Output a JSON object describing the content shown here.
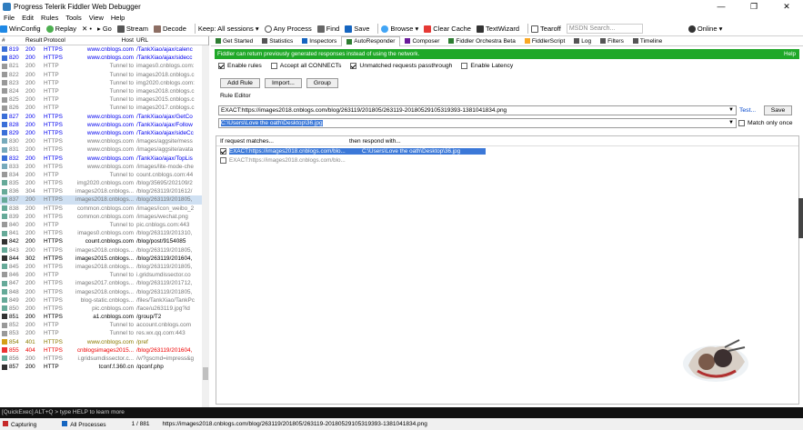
{
  "window": {
    "title": "Progress Telerik Fiddler Web Debugger",
    "minimize": "—",
    "maximize": "❐",
    "close": "✕"
  },
  "menu": [
    "File",
    "Edit",
    "Rules",
    "Tools",
    "View",
    "Help"
  ],
  "toolbar": {
    "winconfig": "WinConfig",
    "replay": "Replay",
    "remove": "✕ •",
    "go": "▸ Go",
    "stream": "Stream",
    "decode": "Decode",
    "keep": "Keep: All sessions ▾",
    "anyprocess": "Any Process",
    "find": "Find",
    "save": "Save",
    "browse": "Browse ▾",
    "clearcache": "Clear Cache",
    "textwizard": "TextWizard",
    "tearoff": "Tearoff",
    "msdn_placeholder": "MSDN Search...",
    "online": "Online ▾"
  },
  "sessions": {
    "headers": {
      "num": "#",
      "result": "Result",
      "protocol": "Protocol",
      "host": "Host",
      "url": "URL"
    },
    "rows": [
      {
        "num": "819",
        "result": "200",
        "protocol": "HTTPS",
        "host": "www.cnblogs.com",
        "url": "/TankXiao/ajax/calenc",
        "style": "rblue",
        "icon": "#3a6fd8"
      },
      {
        "num": "820",
        "result": "200",
        "protocol": "HTTPS",
        "host": "www.cnblogs.com",
        "url": "/TankXiao/ajax/sidecc",
        "style": "rblue",
        "icon": "#3a6fd8"
      },
      {
        "num": "821",
        "result": "200",
        "protocol": "HTTP",
        "host": "Tunnel to",
        "url": "images0.cnblogs.com:",
        "style": "rgray",
        "icon": "#999"
      },
      {
        "num": "822",
        "result": "200",
        "protocol": "HTTP",
        "host": "Tunnel to",
        "url": "images2018.cnblogs.c",
        "style": "rgray",
        "icon": "#999"
      },
      {
        "num": "823",
        "result": "200",
        "protocol": "HTTP",
        "host": "Tunnel to",
        "url": "img2020.cnblogs.com:",
        "style": "rgray",
        "icon": "#999"
      },
      {
        "num": "824",
        "result": "200",
        "protocol": "HTTP",
        "host": "Tunnel to",
        "url": "images2018.cnblogs.c",
        "style": "rgray",
        "icon": "#999"
      },
      {
        "num": "825",
        "result": "200",
        "protocol": "HTTP",
        "host": "Tunnel to",
        "url": "images2015.cnblogs.c",
        "style": "rgray",
        "icon": "#999"
      },
      {
        "num": "826",
        "result": "200",
        "protocol": "HTTP",
        "host": "Tunnel to",
        "url": "images2017.cnblogs.c",
        "style": "rgray",
        "icon": "#999"
      },
      {
        "num": "827",
        "result": "200",
        "protocol": "HTTPS",
        "host": "www.cnblogs.com",
        "url": "/TankXiao/ajax/GetCo",
        "style": "rblue",
        "icon": "#3a6fd8"
      },
      {
        "num": "828",
        "result": "200",
        "protocol": "HTTPS",
        "host": "www.cnblogs.com",
        "url": "/TankXiao/ajax/Follow",
        "style": "rblue",
        "icon": "#3a6fd8"
      },
      {
        "num": "829",
        "result": "200",
        "protocol": "HTTPS",
        "host": "www.cnblogs.com",
        "url": "/TankXiao/ajax/sideCc",
        "style": "rblue",
        "icon": "#3a6fd8"
      },
      {
        "num": "830",
        "result": "200",
        "protocol": "HTTPS",
        "host": "www.cnblogs.com",
        "url": "/images/aggsite/mess",
        "style": "rgray",
        "icon": "#7ab"
      },
      {
        "num": "831",
        "result": "200",
        "protocol": "HTTPS",
        "host": "www.cnblogs.com",
        "url": "/images/aggsite/avata",
        "style": "rgray",
        "icon": "#7ab"
      },
      {
        "num": "832",
        "result": "200",
        "protocol": "HTTPS",
        "host": "www.cnblogs.com",
        "url": "/TankXiao/ajax/TopLis",
        "style": "rblue",
        "icon": "#3a6fd8"
      },
      {
        "num": "833",
        "result": "200",
        "protocol": "HTTPS",
        "host": "www.cnblogs.com",
        "url": "/images/lite-mode-che",
        "style": "rgray",
        "icon": "#7ab"
      },
      {
        "num": "834",
        "result": "200",
        "protocol": "HTTP",
        "host": "Tunnel to",
        "url": "count.cnblogs.com:44",
        "style": "rgray",
        "icon": "#999"
      },
      {
        "num": "835",
        "result": "200",
        "protocol": "HTTPS",
        "host": "img2020.cnblogs.com",
        "url": "/blog/35695/202109/2",
        "style": "rgray",
        "icon": "#6a9"
      },
      {
        "num": "836",
        "result": "304",
        "protocol": "HTTPS",
        "host": "images2018.cnblogs...",
        "url": "/blog/263119/201612/",
        "style": "rgray",
        "icon": "#6a9"
      },
      {
        "num": "837",
        "result": "200",
        "protocol": "HTTPS",
        "host": "images2018.cnblogs...",
        "url": "/blog/263119/201805,",
        "style": "rgray rsel",
        "icon": "#6a9"
      },
      {
        "num": "838",
        "result": "200",
        "protocol": "HTTPS",
        "host": "common.cnblogs.com",
        "url": "/images/icon_weibo_2",
        "style": "rgray",
        "icon": "#6a9"
      },
      {
        "num": "839",
        "result": "200",
        "protocol": "HTTPS",
        "host": "common.cnblogs.com",
        "url": "/images/wechat.png",
        "style": "rgray",
        "icon": "#6a9"
      },
      {
        "num": "840",
        "result": "200",
        "protocol": "HTTP",
        "host": "Tunnel to",
        "url": "pic.cnblogs.com:443",
        "style": "rgray",
        "icon": "#999"
      },
      {
        "num": "841",
        "result": "200",
        "protocol": "HTTPS",
        "host": "images0.cnblogs.com",
        "url": "/blog/263119/201310,",
        "style": "rgray",
        "icon": "#6a9"
      },
      {
        "num": "842",
        "result": "200",
        "protocol": "HTTPS",
        "host": "count.cnblogs.com",
        "url": "/blog/post/9154085",
        "style": "rblack",
        "icon": "#333"
      },
      {
        "num": "843",
        "result": "200",
        "protocol": "HTTPS",
        "host": "images2018.cnblogs...",
        "url": "/blog/263119/201805,",
        "style": "rgray",
        "icon": "#6a9"
      },
      {
        "num": "844",
        "result": "302",
        "protocol": "HTTPS",
        "host": "images2015.cnblogs...",
        "url": "/blog/263119/201604,",
        "style": "rblack",
        "icon": "#333"
      },
      {
        "num": "845",
        "result": "200",
        "protocol": "HTTPS",
        "host": "images2018.cnblogs...",
        "url": "/blog/263119/201805,",
        "style": "rgray",
        "icon": "#6a9"
      },
      {
        "num": "846",
        "result": "200",
        "protocol": "HTTP",
        "host": "Tunnel to",
        "url": "i.gridsumdissector.co",
        "style": "rgray",
        "icon": "#999"
      },
      {
        "num": "847",
        "result": "200",
        "protocol": "HTTPS",
        "host": "images2017.cnblogs...",
        "url": "/blog/263119/201712,",
        "style": "rgray",
        "icon": "#6a9"
      },
      {
        "num": "848",
        "result": "200",
        "protocol": "HTTPS",
        "host": "images2018.cnblogs...",
        "url": "/blog/263119/201805,",
        "style": "rgray",
        "icon": "#6a9"
      },
      {
        "num": "849",
        "result": "200",
        "protocol": "HTTPS",
        "host": "blog-static.cnblogs...",
        "url": "/files/TankXiao/TankPc",
        "style": "rgray",
        "icon": "#6a9"
      },
      {
        "num": "850",
        "result": "200",
        "protocol": "HTTPS",
        "host": "pic.cnblogs.com",
        "url": "/face/u263119.jpg?id",
        "style": "rgray",
        "icon": "#6a9"
      },
      {
        "num": "851",
        "result": "200",
        "protocol": "HTTPS",
        "host": "a1.cnblogs.com",
        "url": "/group/T2",
        "style": "rblack",
        "icon": "#333"
      },
      {
        "num": "852",
        "result": "200",
        "protocol": "HTTP",
        "host": "Tunnel to",
        "url": "account.cnblogs.com",
        "style": "rgray",
        "icon": "#999"
      },
      {
        "num": "853",
        "result": "200",
        "protocol": "HTTP",
        "host": "Tunnel to",
        "url": "res.wx.qq.com:443",
        "style": "rgray",
        "icon": "#999"
      },
      {
        "num": "854",
        "result": "401",
        "protocol": "HTTPS",
        "host": "www.cnblogs.com",
        "url": "/pref",
        "style": "rolive",
        "icon": "#d4a017"
      },
      {
        "num": "855",
        "result": "404",
        "protocol": "HTTPS",
        "host": "cnblogsimages2015...",
        "url": "/blog/263119/201604,",
        "style": "rred",
        "icon": "#e33"
      },
      {
        "num": "856",
        "result": "200",
        "protocol": "HTTPS",
        "host": "i.gridsumdissector.c...",
        "url": "/v/?gscmd=impress&g",
        "style": "rgray",
        "icon": "#6a9"
      },
      {
        "num": "857",
        "result": "200",
        "protocol": "HTTP",
        "host": "tconf.f.360.cn",
        "url": "/qconf.php",
        "style": "rblack",
        "icon": "#333"
      }
    ]
  },
  "quickexec": "[QuickExec] ALT+Q > type HELP to learn more",
  "status": {
    "capturing": "Capturing",
    "processes": "All Processes",
    "count": "1 / 881",
    "url": "https://images2018.cnblogs.com/blog/263119/201805/263119-20180529105319393-1381041834.png"
  },
  "tabs": [
    {
      "label": "Get Started",
      "active": false
    },
    {
      "label": "Statistics",
      "active": false
    },
    {
      "label": "Inspectors",
      "active": false
    },
    {
      "label": "AutoResponder",
      "active": true
    },
    {
      "label": "Composer",
      "active": false
    },
    {
      "label": "Fiddler Orchestra Beta",
      "active": false
    },
    {
      "label": "FiddlerScript",
      "active": false
    },
    {
      "label": "Log",
      "active": false
    },
    {
      "label": "Filters",
      "active": false
    },
    {
      "label": "Timeline",
      "active": false
    }
  ],
  "autoresponder": {
    "info": "Fiddler can return previously generated responses instead of using the network.",
    "help": "Help",
    "checks": [
      {
        "label": "Enable rules",
        "checked": true
      },
      {
        "label": "Accept all CONNECTs",
        "checked": false
      },
      {
        "label": "Unmatched requests passthrough",
        "checked": true
      },
      {
        "label": "Enable Latency",
        "checked": false
      }
    ],
    "buttons": {
      "add": "Add Rule",
      "import": "Import...",
      "group": "Group"
    },
    "rule_editor_label": "Rule Editor",
    "match_value": "EXACT:https://images2018.cnblogs.com/blog/263119/201805/263119-20180529105319393-1381041834.png",
    "respond_value": "C:\\Users\\Love the oath\\Desktop\\36.jpg",
    "test": "Test...",
    "save": "Save",
    "match_only_once": "Match only once",
    "table_headers": {
      "match": "If request matches...",
      "respond": "then respond with..."
    },
    "rules": [
      {
        "match": "EXACT:https://images2018.cnblogs.com/blo...",
        "respond": "C:\\Users\\Love the oath\\Desktop\\36.jpg",
        "checked": true,
        "selected": true
      },
      {
        "match": "EXACT:https://images2018.cnblogs.com/blo...",
        "respond": "",
        "checked": false,
        "selected": false
      }
    ]
  }
}
